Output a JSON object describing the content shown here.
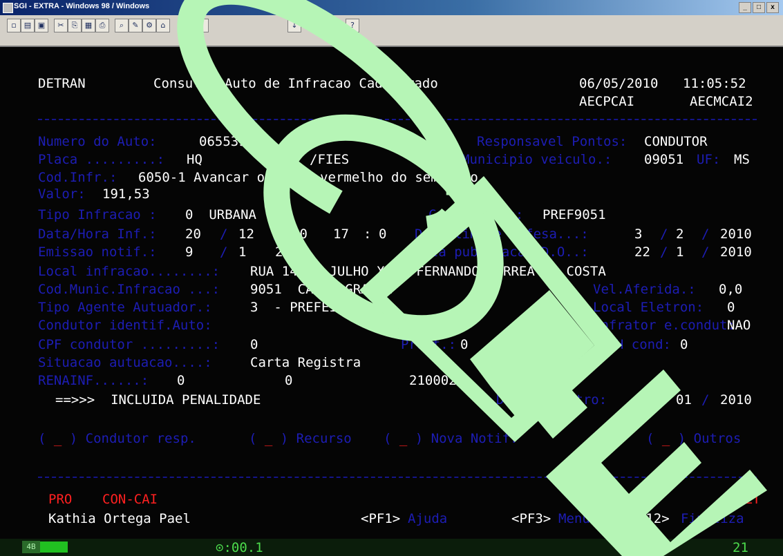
{
  "window": {
    "title": "SGI - EXTRA - Windows 98 / Windows",
    "buttons": [
      "_",
      "□",
      "x"
    ]
  },
  "toolbar": {
    "icons": [
      "new-icon",
      "open-icon",
      "save-icon",
      "cut-icon",
      "copy-icon",
      "paste-icon",
      "print-icon",
      "find-icon",
      "edit-icon",
      "macro-icon",
      "setup-icon",
      "display-icon",
      "send-icon",
      "receive-icon",
      "keyboard-icon",
      "help-icon"
    ]
  },
  "header": {
    "org": "DETRAN",
    "title": "Consulta Auto de Infracao Cadastrado",
    "date": "06/05/2010",
    "time": "11:05:52",
    "prog1": "AECPCAI",
    "prog2": "AECMCAI2"
  },
  "fields": {
    "numero_auto_label": "Numero do Auto:",
    "numero_auto_value": "0655396",
    "resp_pontos_label": "Responsavel Pontos:",
    "resp_pontos_value": "CONDUTOR",
    "placa_label": "Placa .........:",
    "placa_value": "HQ",
    "placa_extra": "/FIES",
    "municipio_label": "Municipio veiculo.:",
    "municipio_value": "09051",
    "uf_label": "UF:",
    "uf_value": "MS",
    "cod_infr_label": "Cod.Infr.:",
    "cod_infr_value": "6050-1 Avancar o sinal vermelho do semaforo",
    "valor_label": "Valor:",
    "valor_value": "191,53",
    "tipo_infracao_label": "Tipo Infracao :",
    "tipo_infracao_value": "0  URBANA",
    "competencia_label": "Competencia:",
    "competencia_value": "PREF9051",
    "data_hora_label": "Data/Hora Inf.:",
    "data_hora_d": "20",
    "data_hora_m": "12",
    "data_hora_y": "20",
    "data_hora_h": "17",
    "data_hora_min": "0",
    "data_def_label": "Data limite defesa...:",
    "data_def_d": "3",
    "data_def_m": "2",
    "data_def_y": "2010",
    "emissao_label": "Emissao notif.:",
    "emissao_d": "9",
    "emissao_m": "1",
    "emissao_y": "20",
    "pub_label": "Data publicacao D.O..:",
    "pub_d": "22",
    "pub_m": "1",
    "pub_y": "2010",
    "local_label": "Local infracao........:",
    "local_value": "RUA 14 DE JULHO X AV FERNANDO CORREA DA COSTA",
    "cod_munic_label": "Cod.Munic.Infracao ...:",
    "cod_munic_value": "9051  CAMPO GRANDE",
    "vel_label": "Vel.Aferida.:",
    "vel_value": "0,0",
    "tipo_agente_label": "Tipo Agente Autuador.:",
    "tipo_agente_value": "3  - PREFEITURA",
    "local_eletron_label": "Local Eletron:",
    "local_eletron_value": "0",
    "condutor_label": "Condutor identif.Auto:",
    "infrator_label": "Infrator e.condut:",
    "infrator_value": "NAO",
    "cpf_label": "CPF condutor .........:",
    "cpf_value": "0",
    "mid_label": "Pront.:",
    "mid_value": "0",
    "cnh_label": "CNH cond:",
    "cnh_value": "0",
    "situacao_label": "Situacao autuacao....:",
    "situacao_value": "Carta Registra",
    "renainf_label": "RENAINF......:",
    "renainf_1": "0",
    "renainf_2": "0",
    "renainf_3": "2100023",
    "renainf_4": "82",
    "message": "==>>>  INCLUIDA PENALIDADE",
    "cadastro_label": "Data cadastro:",
    "cadastro_d": "09",
    "cadastro_m": "01",
    "cadastro_y": "2010"
  },
  "options": [
    {
      "mark": "_",
      "label": "Condutor resp."
    },
    {
      "mark": "_",
      "label": "Recurso"
    },
    {
      "mark": "_",
      "label": "Nova Notif."
    },
    {
      "mark": "_",
      "label": "Outros"
    }
  ],
  "footer": {
    "pro_label": "PRO",
    "pro_value": "CON-CAI",
    "right_code": "ALT",
    "user": "Kathia Ortega Pael",
    "pf1_key": "<PF1>",
    "pf1_label": "Ajuda",
    "pf3_key": "<PF3>",
    "pf3_label": "Menu",
    "pf12_key": "<PF12>",
    "pf12_label": "Finaliza"
  },
  "statusbar": {
    "level": "4B",
    "timer": "⊙:00.1",
    "position": "21"
  },
  "watermark": {
    "text": "CODE",
    "color": "#b6f5b6"
  }
}
